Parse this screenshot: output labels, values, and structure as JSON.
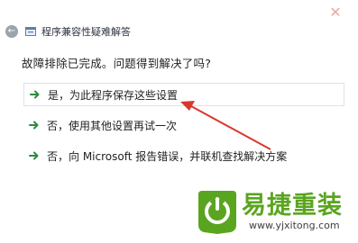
{
  "window": {
    "title": "程序兼容性疑难解答",
    "close_glyph": "✕",
    "back_glyph": "←"
  },
  "question": "故障排除已完成。问题得到解决了吗?",
  "options": [
    {
      "label": "是，为此程序保存这些设置"
    },
    {
      "label": "否，使用其他设置再试一次"
    },
    {
      "label": "否，向 Microsoft 报告错误，并联机查找解决方案"
    }
  ],
  "colors": {
    "arrow_green": "#2f8a3f",
    "annotation_red": "#d9372b",
    "brand_green": "#5aa51f"
  },
  "watermark": {
    "brand": "易捷重装",
    "url": "www.yjxitong.com"
  }
}
